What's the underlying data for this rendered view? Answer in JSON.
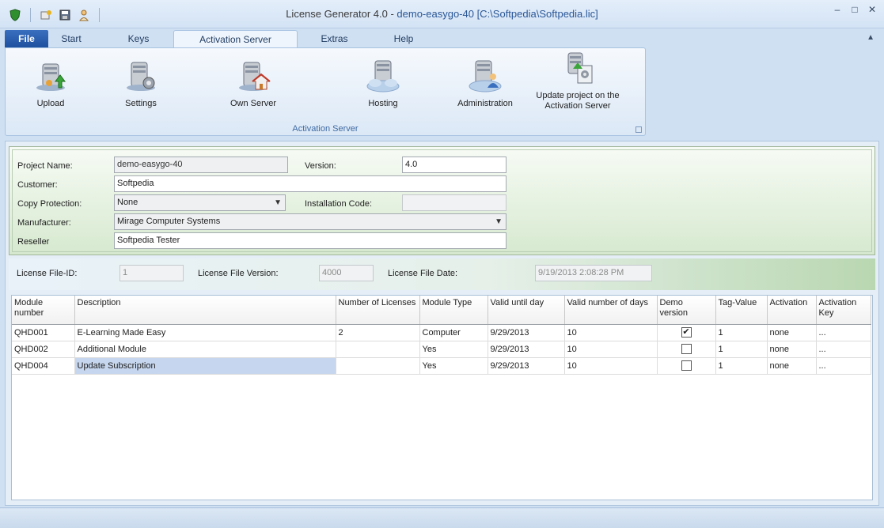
{
  "window": {
    "title": "License Generator 4.0",
    "document": "demo-easygo-40 [C:\\Softpedia\\Softpedia.lic]"
  },
  "tabs": [
    {
      "label": "File"
    },
    {
      "label": "Start"
    },
    {
      "label": "Keys"
    },
    {
      "label": "Activation Server"
    },
    {
      "label": "Extras"
    },
    {
      "label": "Help"
    }
  ],
  "ribbon": {
    "group_label": "Activation Server",
    "buttons": [
      {
        "label": "Upload",
        "icon": "server-upload-icon"
      },
      {
        "label": "Settings",
        "icon": "server-settings-icon"
      },
      {
        "label": "Own Server",
        "icon": "server-home-icon"
      },
      {
        "label": "Hosting",
        "icon": "server-cloud-icon"
      },
      {
        "label": "Administration",
        "icon": "server-admin-icon"
      },
      {
        "label_line1": "Update project on the",
        "label_line2": "Activation Server",
        "icon": "server-update-icon"
      }
    ]
  },
  "project": {
    "project_name_label": "Project Name:",
    "project_name": "demo-easygo-40",
    "version_label": "Version:",
    "version": "4.0",
    "customer_label": "Customer:",
    "customer": "Softpedia",
    "copy_protection_label": "Copy Protection:",
    "copy_protection": "None",
    "installation_code_label": "Installation Code:",
    "installation_code": "",
    "manufacturer_label": "Manufacturer:",
    "manufacturer": "Mirage Computer Systems",
    "reseller_label": "Reseller",
    "reseller": "Softpedia Tester"
  },
  "license_file": {
    "id_label": "License File-ID:",
    "id": "1",
    "version_label": "License File Version:",
    "version": "4000",
    "date_label": "License File Date:",
    "date": "9/19/2013 2:08:28 PM"
  },
  "grid": {
    "headers": [
      "Module number",
      "Description",
      "Number of Licenses",
      "Module Type",
      "Valid until day",
      "Valid number of days",
      "Demo version",
      "Tag-Value",
      "Activation",
      "Activation Key"
    ],
    "rows": [
      {
        "module": "QHD001",
        "description": "E-Learning Made Easy",
        "licenses": "2",
        "type": "Computer",
        "valid_until": "9/29/2013",
        "valid_days": "10",
        "demo": true,
        "tag": "1",
        "activation": "none",
        "key": "..."
      },
      {
        "module": "QHD002",
        "description": "Additional Module",
        "licenses": "",
        "type": "Yes",
        "valid_until": "9/29/2013",
        "valid_days": "10",
        "demo": false,
        "tag": "1",
        "activation": "none",
        "key": "..."
      },
      {
        "module": "QHD004",
        "description": "Update Subscription",
        "licenses": "",
        "type": "Yes",
        "valid_until": "9/29/2013",
        "valid_days": "10",
        "demo": false,
        "tag": "1",
        "activation": "none",
        "key": "..."
      }
    ]
  },
  "colors": {
    "accent": "#1c4f9e",
    "ribbon_group_text": "#3e6aa3",
    "selection": "#c6d6ee"
  }
}
